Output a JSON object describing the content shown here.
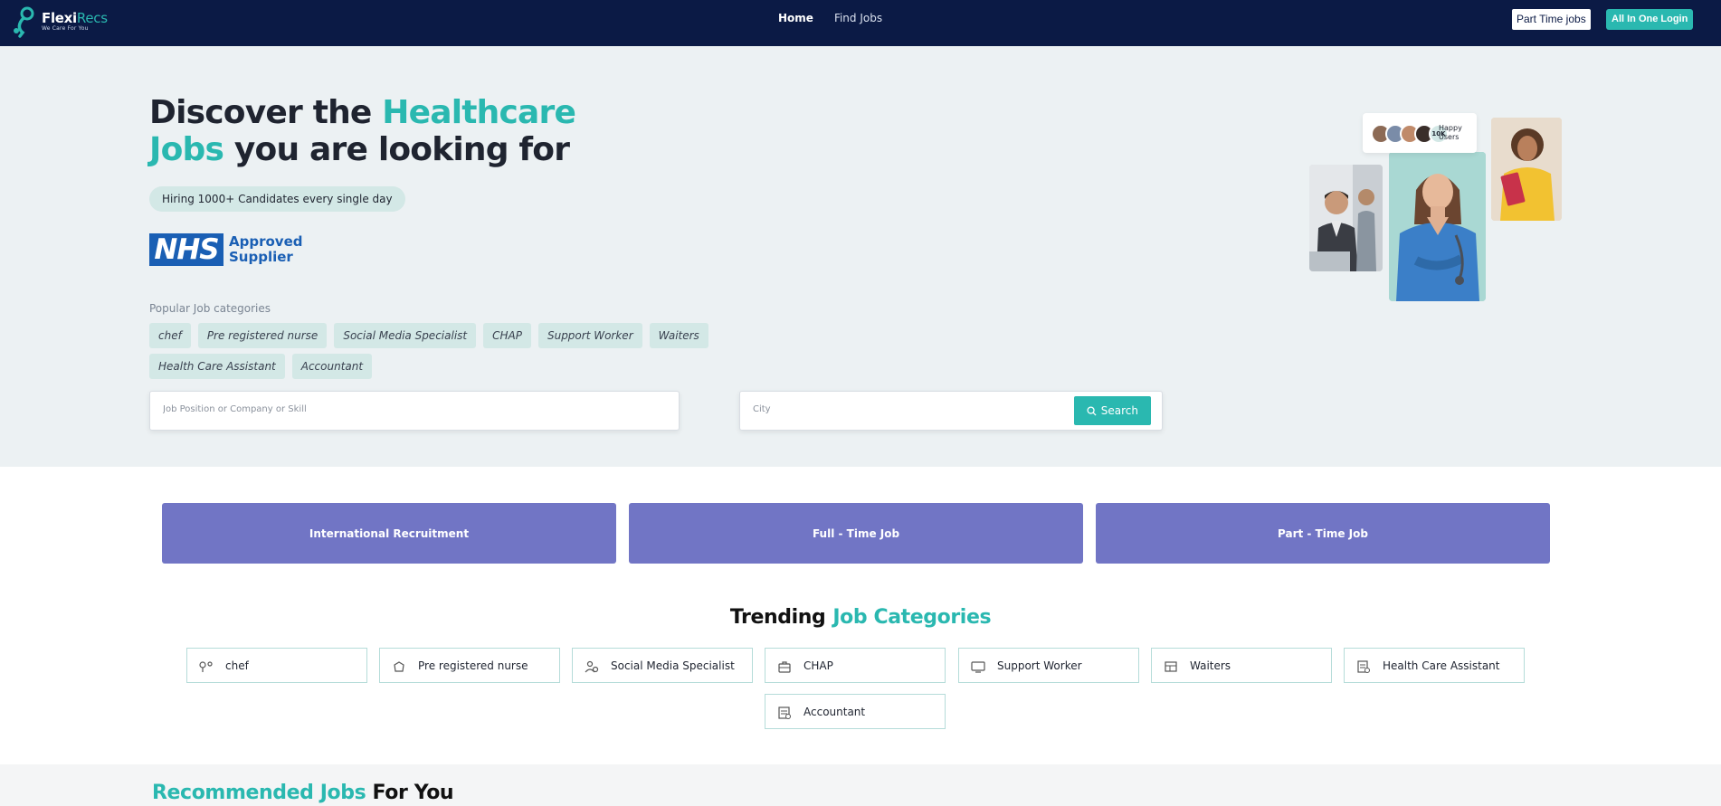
{
  "brand": {
    "name_part1": "Flexi",
    "name_part2": "Recs",
    "tagline": "We Care For You"
  },
  "nav": {
    "links": [
      {
        "label": "Home",
        "active": true
      },
      {
        "label": "Find Jobs",
        "active": false
      }
    ]
  },
  "header_buttons": {
    "part_time": "Part Time jobs",
    "login": "All In One Login"
  },
  "hero": {
    "title_part1": "Discover the ",
    "title_accent1": "Healthcare",
    "title_accent2": "Jobs",
    "title_part2": " you are looking for",
    "hiring_badge": "Hiring 1000+ Candidates every single day",
    "nhs_logo": "NHS",
    "nhs_approved": "Approved",
    "nhs_supplier": "Supplier",
    "popular_label": "Popular Job categories",
    "popular_tags": [
      "chef",
      "Pre registered nurse",
      "Social Media Specialist",
      "CHAP",
      "Support Worker",
      "Waiters",
      "Health Care Assistant",
      "Accountant"
    ],
    "happy_count": "10K",
    "happy_line1": "Happy",
    "happy_line2": "Users"
  },
  "search": {
    "job_placeholder": "Job Position or Company or Skill",
    "city_placeholder": "City",
    "button_label": "Search"
  },
  "features": [
    "International Recruitment",
    "Full - Time Job",
    "Part - Time Job"
  ],
  "trending": {
    "title_part1": "Trending",
    "title_accent": "Job Categories",
    "categories": [
      {
        "label": "chef",
        "icon": "chef-icon"
      },
      {
        "label": "Pre registered nurse",
        "icon": "nurse-cap-icon"
      },
      {
        "label": "Social Media Specialist",
        "icon": "users-icon"
      },
      {
        "label": "CHAP",
        "icon": "briefcase-icon"
      },
      {
        "label": "Support Worker",
        "icon": "monitor-icon"
      },
      {
        "label": "Waiters",
        "icon": "tray-icon"
      },
      {
        "label": "Health Care Assistant",
        "icon": "document-icon"
      },
      {
        "label": "Accountant",
        "icon": "calculator-icon"
      }
    ]
  },
  "recommended": {
    "title_accent": "Recommended Jobs",
    "title_part2": " For You"
  },
  "colors": {
    "navy": "#0b1a45",
    "teal": "#2ab8b0",
    "purple": "#7175c5",
    "nhs_blue": "#1a5fb4"
  }
}
